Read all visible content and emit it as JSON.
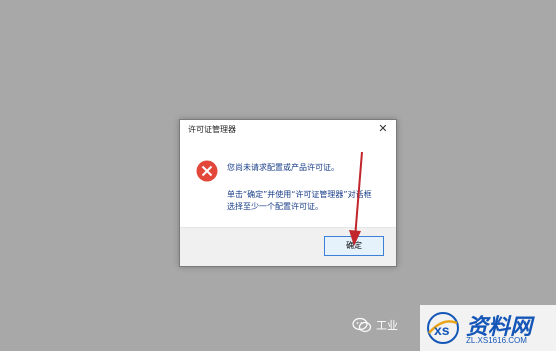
{
  "dialog": {
    "title": "许可证管理器",
    "close_glyph": "✕",
    "message_main": "您尚未请求配置或产品许可证。",
    "message_detail_line1": "单击“确定”并使用“许可证管理器”对话框",
    "message_detail_line2": "选择至少一个配置许可证。",
    "ok_label": "确定",
    "icon": "error-icon",
    "colors": {
      "background": "#a8a8a8",
      "icon_red": "#e2473a",
      "message_text": "#1a3f8a",
      "button_border": "#3c7fd6",
      "arrow": "#c0262b"
    }
  },
  "watermark": {
    "left_text": "工业",
    "right_title": "资料网",
    "right_url": "ZL.XS1616.COM"
  }
}
